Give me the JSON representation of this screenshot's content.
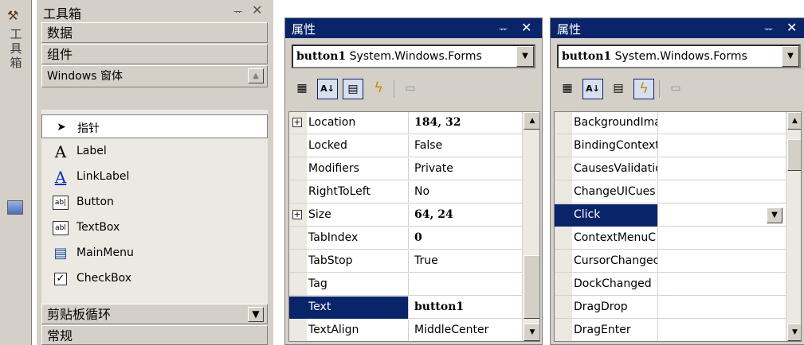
{
  "vertical_strip": {
    "title_chars": [
      "工",
      "具",
      "箱"
    ]
  },
  "toolbox": {
    "title": "工具箱",
    "pin": "ᅲ",
    "close": "✕",
    "categories_top": [
      "数据",
      "组件",
      "Windows 窗体"
    ],
    "items": [
      {
        "icon": "pointer-arrow-icon",
        "glyph": "➤",
        "label": "指针"
      },
      {
        "icon": "label-icon",
        "glyph": "A",
        "label": "Label"
      },
      {
        "icon": "linklabel-icon",
        "glyph": "A",
        "label": "LinkLabel"
      },
      {
        "icon": "button-icon",
        "glyph": "ab|",
        "label": "Button"
      },
      {
        "icon": "textbox-icon",
        "glyph": "abl",
        "label": "TextBox"
      },
      {
        "icon": "mainmenu-icon",
        "glyph": "▤",
        "label": "MainMenu"
      },
      {
        "icon": "checkbox-icon",
        "glyph": "✓",
        "label": "CheckBox"
      }
    ],
    "categories_bottom": [
      "剪贴板循环",
      "常规"
    ]
  },
  "properties_left": {
    "title": "属性",
    "pin": "ᅲ",
    "close": "✕",
    "object_name": "button1",
    "object_type": "System.Windows.Forms",
    "rows": [
      {
        "name": "Location",
        "value": "184, 32",
        "bold": true,
        "expand": "+"
      },
      {
        "name": "Locked",
        "value": "False"
      },
      {
        "name": "Modifiers",
        "value": "Private"
      },
      {
        "name": "RightToLeft",
        "value": "No"
      },
      {
        "name": "Size",
        "value": "64, 24",
        "bold": true,
        "expand": "+"
      },
      {
        "name": "TabIndex",
        "value": "0",
        "bold": true
      },
      {
        "name": "TabStop",
        "value": "True"
      },
      {
        "name": "Tag",
        "value": ""
      },
      {
        "name": "Text",
        "value": "button1",
        "bold": true,
        "selected": true
      },
      {
        "name": "TextAlign",
        "value": "MiddleCenter"
      }
    ]
  },
  "properties_right": {
    "title": "属性",
    "pin": "ᅲ",
    "close": "✕",
    "object_name": "button1",
    "object_type": "System.Windows.Forms",
    "rows": [
      {
        "name": "BackgroundIma",
        "value": ""
      },
      {
        "name": "BindingContext",
        "value": ""
      },
      {
        "name": "CausesValidatic",
        "value": ""
      },
      {
        "name": "ChangeUICues",
        "value": ""
      },
      {
        "name": "Click",
        "value": "",
        "selected": true
      },
      {
        "name": "ContextMenuC",
        "value": ""
      },
      {
        "name": "CursorChangec",
        "value": ""
      },
      {
        "name": "DockChanged",
        "value": ""
      },
      {
        "name": "DragDrop",
        "value": ""
      },
      {
        "name": "DragEnter",
        "value": ""
      }
    ]
  },
  "colors": {
    "caption": "#0a246a",
    "face": "#d4d0c8",
    "selection": "#0a246a"
  }
}
